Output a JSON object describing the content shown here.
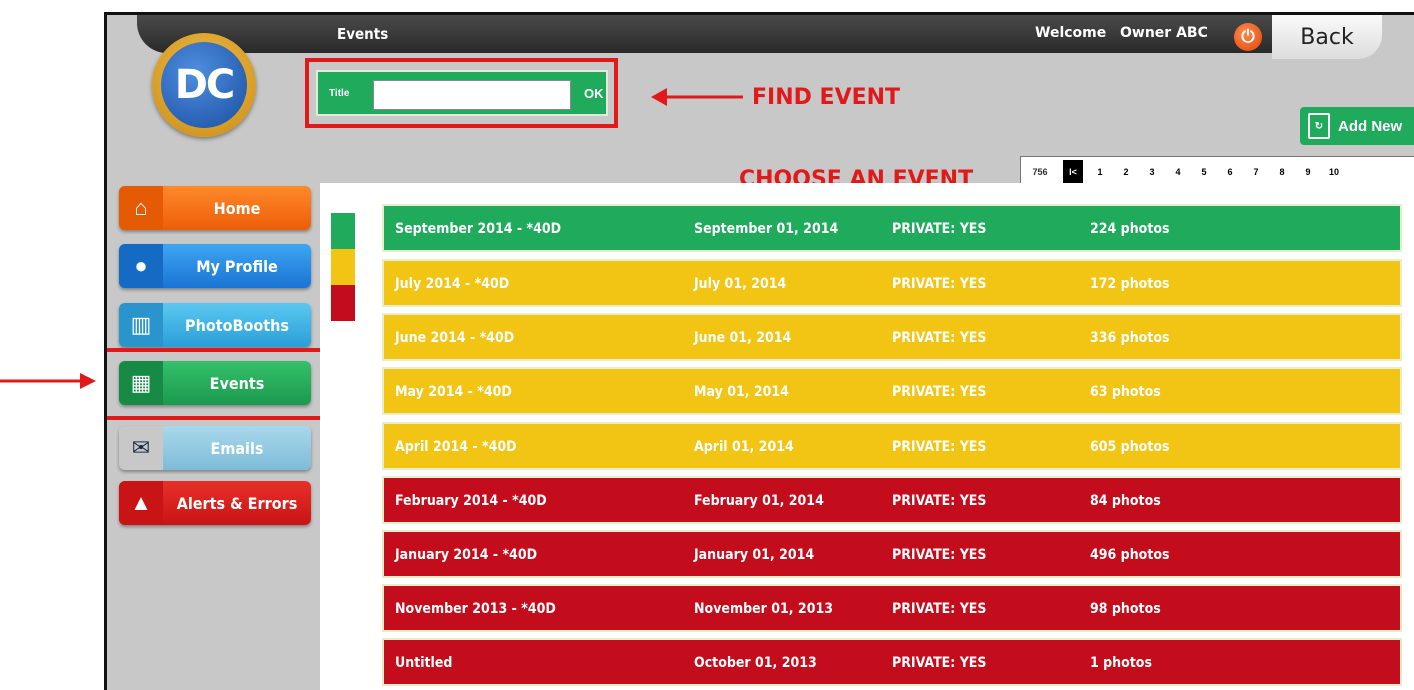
{
  "header": {
    "title": "Events",
    "welcome_label": "Welcome",
    "username": "Owner ABC",
    "back_label": "Back"
  },
  "logo": {
    "text": "DC"
  },
  "search": {
    "label": "Title",
    "value": "",
    "ok_label": "OK"
  },
  "add_new_label": "Add New",
  "pagination": {
    "total": "756",
    "first": "I<",
    "pages": [
      "1",
      "2",
      "3",
      "4",
      "5",
      "6",
      "7",
      "8",
      "9",
      "10"
    ]
  },
  "annotations": {
    "find_event": "FIND EVENT",
    "choose_event": "CHOOSE AN EVENT"
  },
  "sidebar": {
    "items": [
      {
        "label": "Home",
        "icon": "home-icon"
      },
      {
        "label": "My Profile",
        "icon": "user-icon"
      },
      {
        "label": "PhotoBooths",
        "icon": "photobooth-icon"
      },
      {
        "label": "Events",
        "icon": "calendar-icon",
        "active": true
      },
      {
        "label": "Emails",
        "icon": "envelope-icon"
      },
      {
        "label": "Alerts & Errors",
        "icon": "warning-icon"
      }
    ]
  },
  "legend_colors": [
    "#1faa5c",
    "#f2c414",
    "#c30d1c"
  ],
  "events": [
    {
      "title": "September 2014 - *40D",
      "date": "September 01, 2014",
      "private": "PRIVATE: YES",
      "photos": "224 photos",
      "status": "green"
    },
    {
      "title": "July 2014 - *40D",
      "date": "July 01, 2014",
      "private": "PRIVATE: YES",
      "photos": "172 photos",
      "status": "yellow"
    },
    {
      "title": "June 2014 - *40D",
      "date": "June 01, 2014",
      "private": "PRIVATE: YES",
      "photos": "336 photos",
      "status": "yellow"
    },
    {
      "title": "May 2014 - *40D",
      "date": "May 01, 2014",
      "private": "PRIVATE: YES",
      "photos": "63 photos",
      "status": "yellow"
    },
    {
      "title": "April 2014 - *40D",
      "date": "April 01, 2014",
      "private": "PRIVATE: YES",
      "photos": "605 photos",
      "status": "yellow"
    },
    {
      "title": "February 2014 - *40D",
      "date": "February 01, 2014",
      "private": "PRIVATE: YES",
      "photos": "84 photos",
      "status": "red"
    },
    {
      "title": "January 2014 - *40D",
      "date": "January 01, 2014",
      "private": "PRIVATE: YES",
      "photos": "496 photos",
      "status": "red"
    },
    {
      "title": "November 2013 - *40D",
      "date": "November 01, 2013",
      "private": "PRIVATE: YES",
      "photos": "98 photos",
      "status": "red"
    },
    {
      "title": "Untitled",
      "date": "October 01, 2013",
      "private": "PRIVATE: YES",
      "photos": "1 photos",
      "status": "red"
    }
  ],
  "colors": {
    "green": "#1faa5c",
    "yellow": "#f2c414",
    "red": "#c30d1c",
    "annotation": "#e01a1a"
  }
}
